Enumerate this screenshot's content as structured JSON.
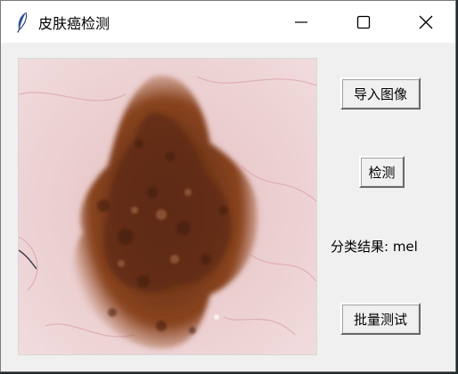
{
  "window": {
    "title": "皮肤癌检测",
    "app_icon": "feather-icon",
    "controls": {
      "minimize_icon": "minimize-icon",
      "maximize_icon": "maximize-icon",
      "close_icon": "close-icon"
    }
  },
  "main": {
    "image_preview": {
      "content": "dermoscopy-lesion-image"
    },
    "buttons": {
      "import_label": "导入图像",
      "detect_label": "检测",
      "batch_label": "批量测试"
    },
    "result": {
      "text": "分类结果: mel"
    }
  },
  "colors": {
    "titlebar": "#ffffff",
    "window_bg": "#f0f0f0",
    "skin": "#e8c6c9",
    "lesion_dark": "#5a2a12",
    "lesion_mid": "#8a4520"
  }
}
